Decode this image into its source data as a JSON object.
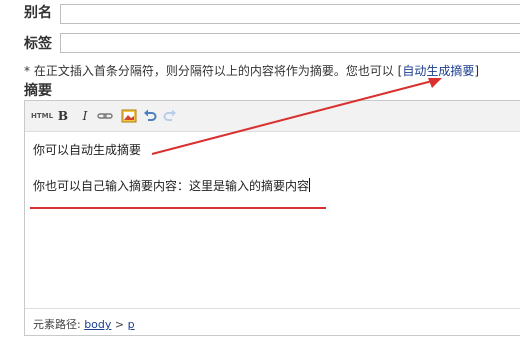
{
  "alias": {
    "label": "别名",
    "value": ""
  },
  "tags": {
    "label": "标签",
    "value": ""
  },
  "hint": {
    "text": "* 在正文插入首条分隔符，则分隔符以上的内容将作为摘要。您也可以 ",
    "link_open": "[",
    "link_label": "自动生成摘要",
    "link_close": "]"
  },
  "summary": {
    "label": "摘要",
    "toolbar": {
      "html_label": "HTML",
      "bold_label": "B",
      "italic_label": "I",
      "icons": [
        "link-icon",
        "image-icon",
        "undo-icon",
        "redo-icon"
      ]
    },
    "content": {
      "line1": "你可以自动生成摘要",
      "line2": "你也可以自己输入摘要内容：这里是输入的摘要内容"
    },
    "statusbar": {
      "prefix": "元素路径: ",
      "path": [
        "body",
        "p"
      ],
      "separator": " > "
    }
  },
  "colors": {
    "annotation_red": "#d93030",
    "link_blue": "#1a3f8f"
  }
}
